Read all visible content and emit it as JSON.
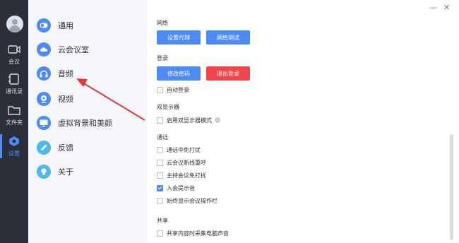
{
  "rail": {
    "items": [
      {
        "label": "会议",
        "icon": "video-camera-icon"
      },
      {
        "label": "通讯录",
        "icon": "contacts-book-icon"
      },
      {
        "label": "文件夹",
        "icon": "folder-icon"
      },
      {
        "label": "设置",
        "icon": "settings-hexagon-icon"
      }
    ]
  },
  "menu": {
    "items": [
      {
        "label": "通用",
        "icon": "toggle-icon",
        "color": "#4c8bf5"
      },
      {
        "label": "云会议室",
        "icon": "cloud-icon",
        "color": "#4c8bf5"
      },
      {
        "label": "音频",
        "icon": "headphones-icon",
        "color": "#4c8bf5"
      },
      {
        "label": "视频",
        "icon": "webcam-icon",
        "color": "#4c8bf5"
      },
      {
        "label": "虚拟背景和美颜",
        "icon": "monitor-icon",
        "color": "#4c8bf5"
      },
      {
        "label": "反馈",
        "icon": "pencil-icon",
        "color": "#4db8f0"
      },
      {
        "label": "关于",
        "icon": "bulb-icon",
        "color": "#4db8f0"
      }
    ]
  },
  "window": {
    "minimize": "—",
    "close": "✕"
  },
  "network": {
    "title": "网络",
    "proxy_button": "设置代理",
    "test_button": "网络测试"
  },
  "login": {
    "title": "登录",
    "change_password_button": "修改密码",
    "logout_button": "退出登录",
    "auto_login": {
      "label": "自动登录",
      "checked": false
    }
  },
  "display": {
    "title": "双显示器",
    "dual_display": {
      "label": "启用双显示器模式",
      "checked": false
    }
  },
  "call": {
    "title": "通话",
    "options": [
      {
        "label": "通话中免打扰",
        "checked": false
      },
      {
        "label": "云会议断线重呼",
        "checked": false
      },
      {
        "label": "主持会议免打扰",
        "checked": false
      },
      {
        "label": "入会提示音",
        "checked": true
      },
      {
        "label": "始终显示会议操作栏",
        "checked": false
      }
    ]
  },
  "share": {
    "title": "共享",
    "capture_audio": {
      "label": "共享内容时采集电脑声音",
      "checked": false
    }
  },
  "colors": {
    "accent": "#4c8bf5",
    "danger": "#f0464b",
    "rail": "#2a2f3a",
    "arrow": "#e53935"
  }
}
